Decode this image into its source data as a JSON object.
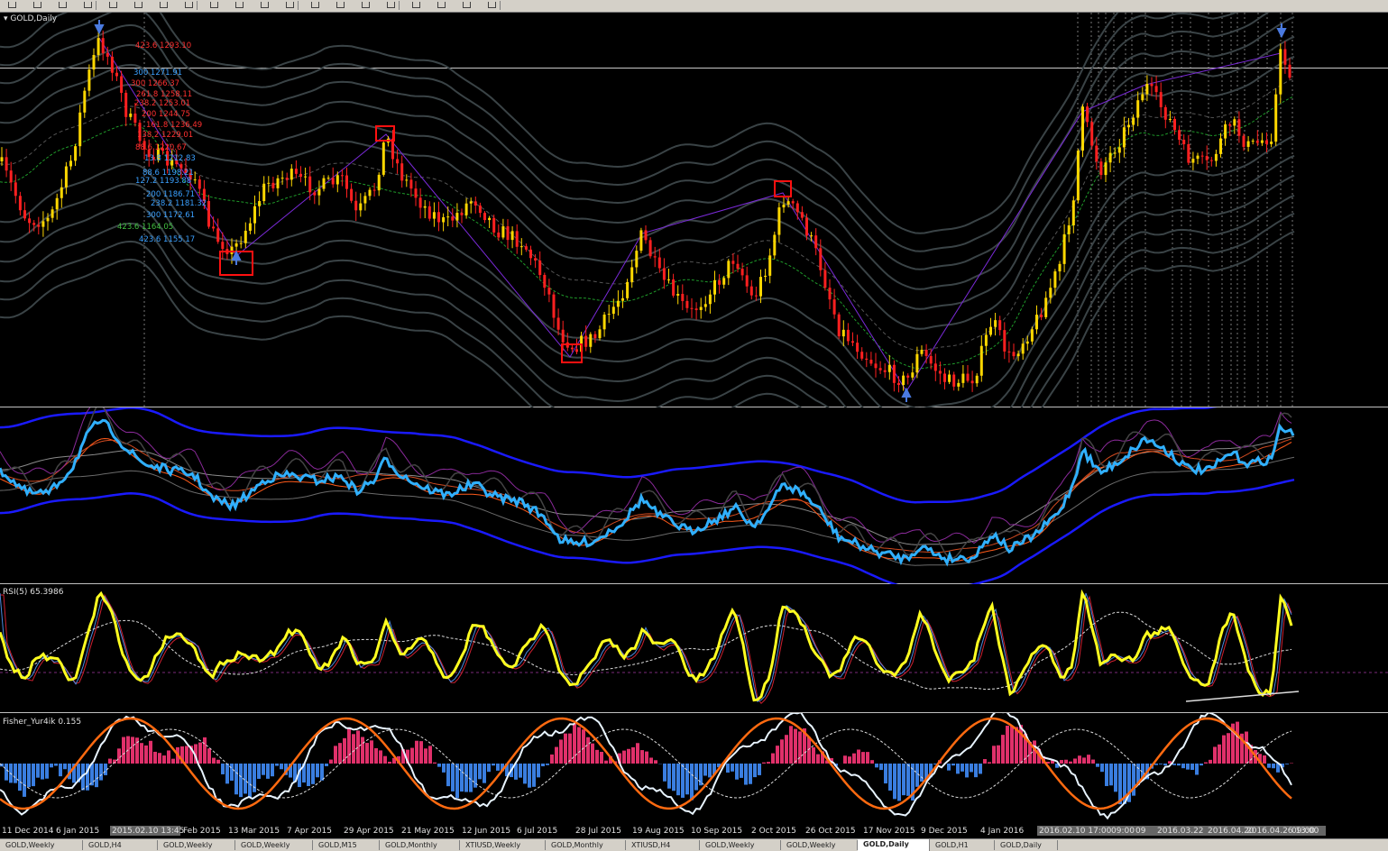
{
  "toolbar": {
    "icons": [
      "new-chart-icon",
      "bar-chart-icon",
      "candle-icon",
      "line-chart-icon",
      "zoom-in-icon",
      "zoom-out-icon",
      "tile-icon",
      "scroll-icon",
      "shift-icon",
      "autoscroll-icon",
      "indicators-icon",
      "period-icon",
      "templates-icon",
      "add-icon",
      "crosshair-icon",
      "expert-icon",
      "line-tool-icon",
      "fib-icon",
      "text-icon",
      "arrow-icon"
    ]
  },
  "main_pane": {
    "title": "GOLD,Daily",
    "price_line_color": "#c8c8c8"
  },
  "rsi_pane": {
    "title": "RSI(5) 65.3986"
  },
  "fisher_pane": {
    "title": "Fisher_Yur4ik  0.155"
  },
  "fib_levels": [
    {
      "text": "423.6  1293.10",
      "color": "#ff3030"
    },
    {
      "text": "300  1271.91",
      "color": "#3aa0ff"
    },
    {
      "text": "300  1266.37",
      "color": "#ff3030"
    },
    {
      "text": "261.8  1258.11",
      "color": "#ff3030"
    },
    {
      "text": "238.2  1253.01",
      "color": "#ff3030"
    },
    {
      "text": "200  1244.75",
      "color": "#ff3030"
    },
    {
      "text": "161.8  1236.49",
      "color": "#ff3030"
    },
    {
      "text": "138.2  1229.01",
      "color": "#ff3030"
    },
    {
      "text": "88.6  1220.67",
      "color": "#ff3030"
    },
    {
      "text": "13.8  1212.83",
      "color": "#3aa0ff"
    },
    {
      "text": "88.6  1198.21",
      "color": "#3aa0ff"
    },
    {
      "text": "127.2  1193.88",
      "color": "#3aa0ff"
    },
    {
      "text": "200  1186.71",
      "color": "#3aa0ff"
    },
    {
      "text": "238.2  1181.32",
      "color": "#3aa0ff"
    },
    {
      "text": "300  1172.61",
      "color": "#3aa0ff"
    },
    {
      "text": "423.6  1164.05",
      "color": "#40c040"
    },
    {
      "text": "423.6  1155.17",
      "color": "#3aa0ff"
    }
  ],
  "date_axis": {
    "labels": [
      "11 Dec 2014",
      "6 Jan 2015",
      "2015.02.10 13:45",
      "Feb 2015",
      "13 Mar 2015",
      "7 Apr 2015",
      "29 Apr 2015",
      "21 May 2015",
      "12 Jun 2015",
      "6 Jul 2015",
      "28 Jul 2015",
      "19 Aug 2015",
      "10 Sep 2015",
      "2 Oct 2015",
      "26 Oct 2015",
      "17 Nov 2015",
      "9 Dec 2015",
      "4 Jan 2016",
      "2016.02.10 17:00",
      "09:00",
      "09",
      "2016.03.22",
      "2016.04.20",
      "2016.04.26 13:00",
      "09:00"
    ]
  },
  "tabs": [
    {
      "label": "GOLD,Weekly"
    },
    {
      "label": "GOLD,H4"
    },
    {
      "label": "GOLD,Weekly"
    },
    {
      "label": "GOLD,Weekly"
    },
    {
      "label": "GOLD,M15"
    },
    {
      "label": "GOLD,Monthly"
    },
    {
      "label": "XTIUSD,Weekly"
    },
    {
      "label": "GOLD,Monthly"
    },
    {
      "label": "XTIUSD,H4"
    },
    {
      "label": "GOLD,Weekly"
    },
    {
      "label": "GOLD,Weekly"
    },
    {
      "label": "GOLD,Daily"
    },
    {
      "label": "GOLD,H1"
    },
    {
      "label": "GOLD,Daily"
    }
  ],
  "active_tab_index": 11,
  "colors": {
    "bull_candle": "#ffd700",
    "bear_candle": "#ff2020",
    "rsi": "#ffff20",
    "bands_blue": "#1a1aff",
    "oscillator_cyan": "#30b0ff",
    "fisher_orange": "#ff6a10",
    "hist_pos": "#e0306a",
    "hist_neg": "#3a7ee0",
    "marker_box": "#ff1010"
  }
}
